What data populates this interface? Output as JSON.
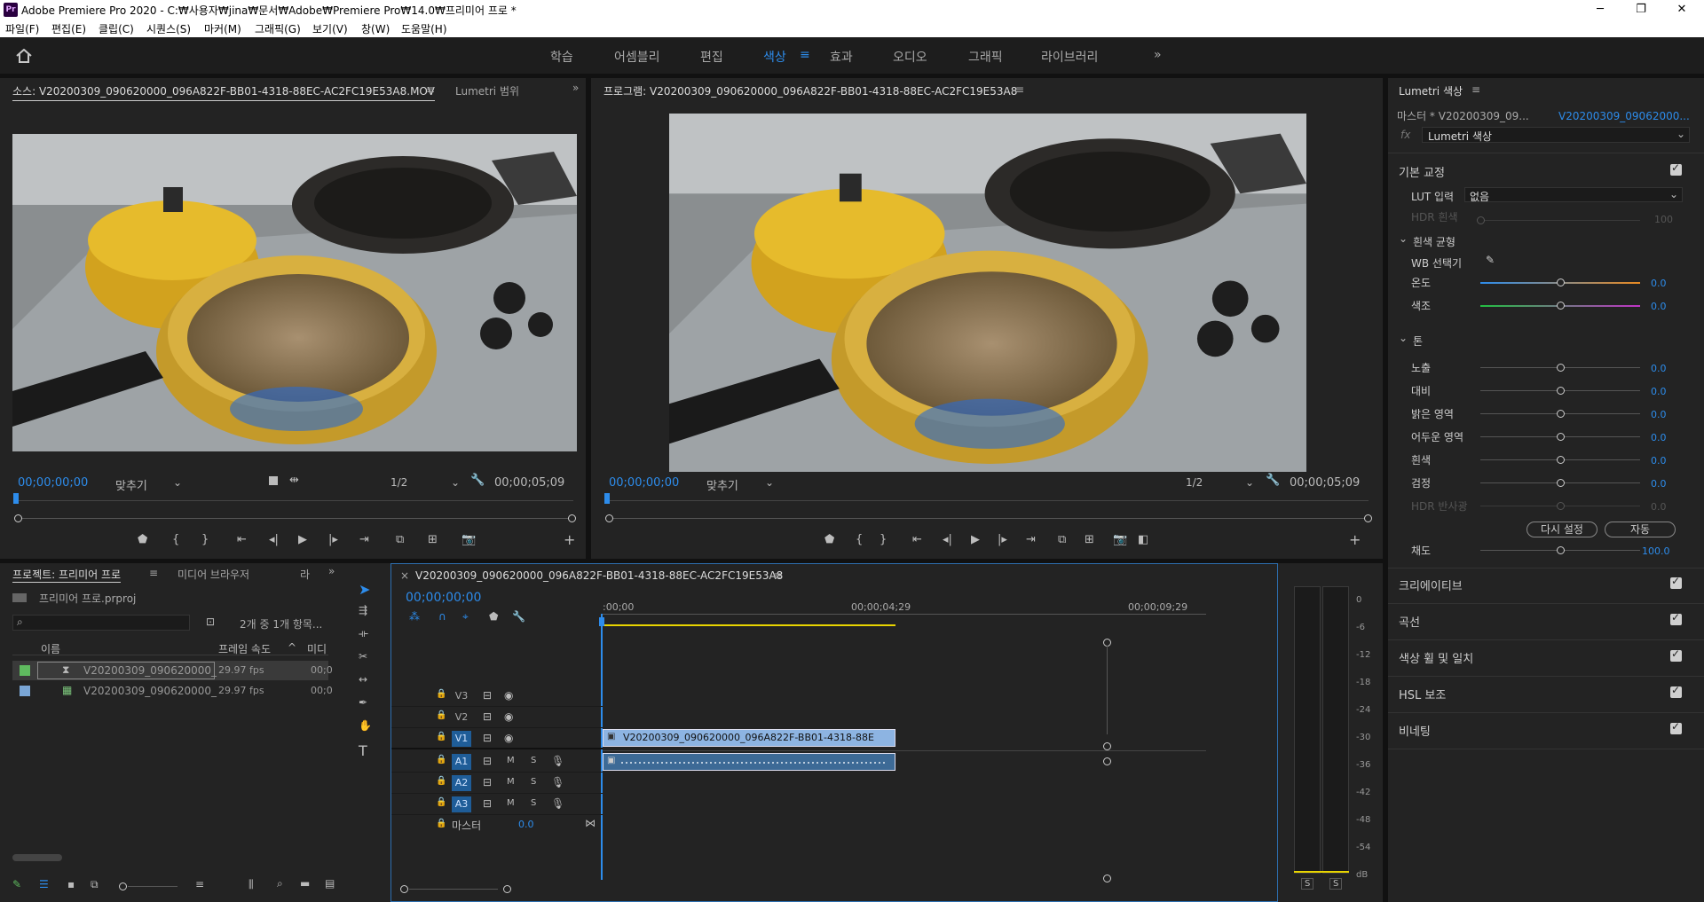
{
  "titlebar": {
    "app_badge": "Pr",
    "title": "Adobe Premiere Pro 2020 - C:₩사용자₩jina₩문서₩Adobe₩Premiere Pro₩14.0₩프리미어 프로 *",
    "minimize": "─",
    "maximize": "❐",
    "close": "✕"
  },
  "menu": [
    "파일(F)",
    "편집(E)",
    "클립(C)",
    "시퀀스(S)",
    "마커(M)",
    "그래픽(G)",
    "보기(V)",
    "창(W)",
    "도움말(H)"
  ],
  "workspaces": [
    "학습",
    "어셈블리",
    "편집",
    "색상",
    "효과",
    "오디오",
    "그래픽",
    "라이브러리"
  ],
  "workspace_menu": "≡",
  "more": "»",
  "source": {
    "tab": "소스: V20200309_090620000_096A822F-BB01-4318-88EC-AC2FC19E53A8.MOV",
    "menu": "≡",
    "tab2": "Lumetri 범위",
    "timecode": "00;00;00;00",
    "fit": "맞추기",
    "resolution": "1/2",
    "duration": "00;00;05;09"
  },
  "program": {
    "tab": "프로그램: V20200309_090620000_096A822F-BB01-4318-88EC-AC2FC19E53A8",
    "menu": "≡",
    "timecode": "00;00;00;00",
    "fit": "맞추기",
    "resolution": "1/2",
    "duration": "00;00;05;09"
  },
  "project": {
    "tab": "프로젝트: 프리미어 프로",
    "menu": "≡",
    "tab2": "미디어 브라우저",
    "tab3": "라",
    "file": "프리미어 프로.prproj",
    "count": "2개 중 1개 항목...",
    "col_name": "이름",
    "col_fps": "프레임 속도",
    "col_media": "미디",
    "items": [
      {
        "name": "V20200309_090620000_",
        "fps": "29.97 fps",
        "start": "00;0",
        "color": "#5fba5f"
      },
      {
        "name": "V20200309_090620000_",
        "fps": "29.97 fps",
        "start": "00;0",
        "color": "#7aa6d6"
      }
    ]
  },
  "timeline": {
    "close": "×",
    "tab": "V20200309_090620000_096A822F-BB01-4318-88EC-AC2FC19E53A8",
    "menu": "≡",
    "timecode": "00;00;00;00",
    "ruler": [
      ":00;00",
      "00;00;04;29",
      "00;00;09;29"
    ],
    "tracks_video": [
      "V3",
      "V2",
      "V1"
    ],
    "tracks_audio": [
      "A1",
      "A2",
      "A3"
    ],
    "master_label": "마스터",
    "master_value": "0.0",
    "clip_label": "V20200309_090620000_096A822F-BB01-4318-88E",
    "mute": "M",
    "solo": "S"
  },
  "meter": {
    "scale": [
      "0",
      "-6",
      "-12",
      "-18",
      "-24",
      "-30",
      "-36",
      "-42",
      "-48",
      "-54",
      "dB"
    ],
    "solo_left": "S",
    "solo_right": "S"
  },
  "lumetri": {
    "tab": "Lumetri 색상",
    "menu": "≡",
    "master": "마스터 * V20200309_09...",
    "clip": "V20200309_09062000...",
    "fx": "fx",
    "effect": "Lumetri 색상",
    "basic": "기본 교정",
    "lut_label": "LUT 입력",
    "lut_value": "없음",
    "hdr_label": "HDR 흰색",
    "hdr_value": "100",
    "wb_section": "흰색 균형",
    "wb_picker": "WB 선택기",
    "tone_section": "톤",
    "sliders": [
      {
        "label": "온도",
        "value": "0.0"
      },
      {
        "label": "색조",
        "value": "0.0"
      },
      {
        "label": "노출",
        "value": "0.0"
      },
      {
        "label": "대비",
        "value": "0.0"
      },
      {
        "label": "밝은 영역",
        "value": "0.0"
      },
      {
        "label": "어두운 영역",
        "value": "0.0"
      },
      {
        "label": "흰색",
        "value": "0.0"
      },
      {
        "label": "검정",
        "value": "0.0"
      },
      {
        "label": "HDR 반사광",
        "value": "0.0"
      }
    ],
    "reset": "다시 설정",
    "auto": "자동",
    "saturation_label": "채도",
    "saturation_value": "100.0",
    "sections": [
      "크리에이티브",
      "곡선",
      "색상 휠 및 일치",
      "HSL 보조",
      "비네팅"
    ]
  },
  "colors": {
    "accent": "#2d8ceb",
    "playhead": "#2d8ceb",
    "clip_video": "#8db4e2",
    "clip_audio": "#3d6a96",
    "work_area": "#e8d400"
  }
}
